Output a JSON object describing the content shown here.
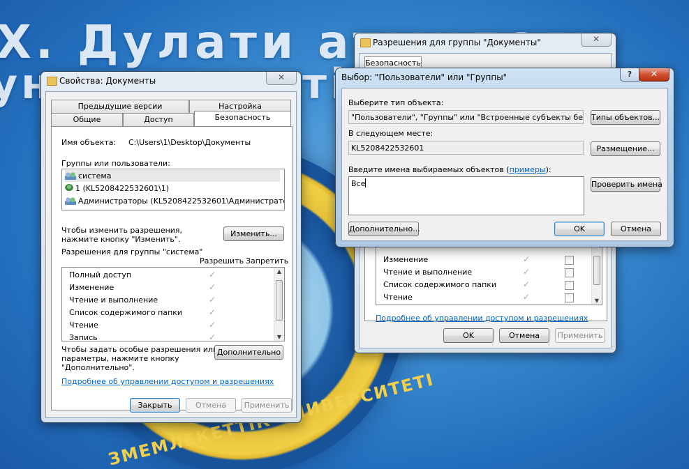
{
  "wallpaper": {
    "line1": "Х. Дулати атындағы",
    "line2": "университеті",
    "emblem_text": "ЗМЕМЛЕКЕТТІК УНИВЕРСИТЕТІ"
  },
  "props_window": {
    "title": "Свойства: Документы",
    "close": "✕",
    "tabs_row1": [
      "Предыдущие версии",
      "Настройка"
    ],
    "tabs_row2": [
      "Общие",
      "Доступ",
      "Безопасность"
    ],
    "object_name_label": "Имя объекта:",
    "object_name_value": "C:\\Users\\1\\Desktop\\Документы",
    "groups_label": "Группы или пользователи:",
    "users": [
      "система",
      "1 (KL5208422532601\\1)",
      "Администраторы (KL5208422532601\\Администраторы)"
    ],
    "change_hint": "Чтобы изменить разрешения,\nнажмите кнопку \"Изменить\".",
    "change_hint_line1": "Чтобы изменить разрешения,",
    "change_hint_line2": "нажмите кнопку \"Изменить\".",
    "change_button": "Изменить...",
    "perm_label": "Разрешения для группы \"система\"",
    "allow_header": "Разрешить",
    "deny_header": "Запретить",
    "permissions": [
      "Полный доступ",
      "Изменение",
      "Чтение и выполнение",
      "Список содержимого папки",
      "Чтение",
      "Запись"
    ],
    "special_hint_line1": "Чтобы задать особые разрешения или",
    "special_hint_line2": "параметры, нажмите кнопку",
    "special_hint_line3": "\"Дополнительно\".",
    "advanced_button": "Дополнительно",
    "help_link": "Подробнее об управлении доступом и разрешениях",
    "ok_button": "Закрыть",
    "cancel_button": "Отмена",
    "apply_button": "Применить"
  },
  "perm_window": {
    "title": "Разрешения для группы \"Документы\"",
    "close": "✕",
    "tab_security": "Безопасность",
    "permissions": [
      "Изменение",
      "Чтение и выполнение",
      "Список содержимого папки",
      "Чтение"
    ],
    "help_link": "Подробнее об управлении доступом и разрешениях",
    "ok_button": "OK",
    "cancel_button": "Отмена",
    "apply_button": "Применить"
  },
  "select_window": {
    "title": "Выбор: \"Пользователи\" или \"Группы\"",
    "help": "?",
    "close": "✕",
    "object_type_label": "Выберите тип объекта:",
    "object_type_value": "\"Пользователи\", \"Группы\" или \"Встроенные субъекты безопасн",
    "object_types_button": "Типы объектов...",
    "location_label": "В следующем месте:",
    "location_value": "KL5208422532601",
    "location_button": "Размещение...",
    "names_label": "Введите имена выбираемых объектов (",
    "names_link": "примеры",
    "names_label_end": "):",
    "names_value": "Все",
    "check_names_button": "Проверить имена",
    "advanced_button": "Дополнительно...",
    "ok_button": "OK",
    "cancel_button": "Отмена"
  }
}
